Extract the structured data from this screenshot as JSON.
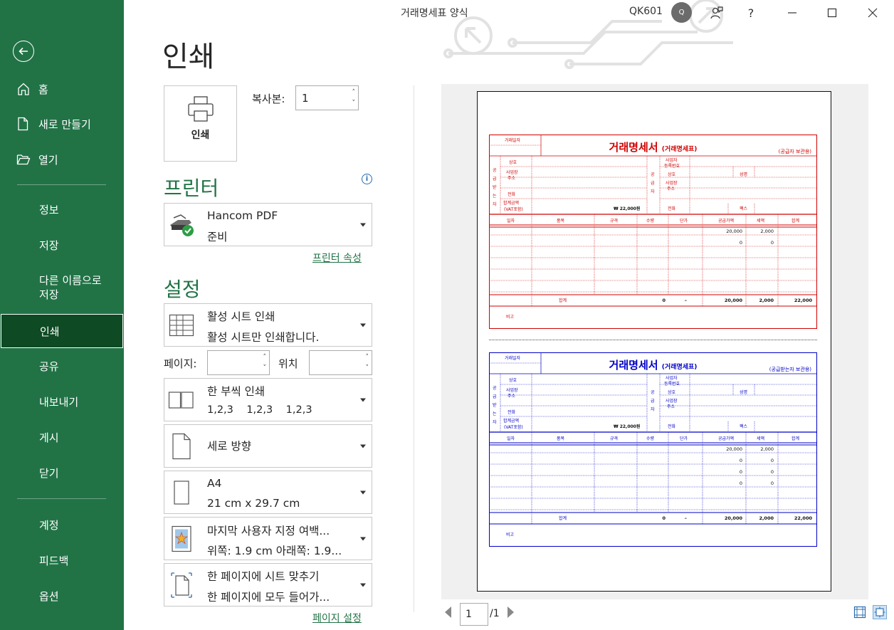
{
  "window": {
    "title": "거래명세표 양식",
    "user": "QK601",
    "avatar": "Q",
    "help": "?"
  },
  "nav": {
    "items": [
      {
        "label": "홈",
        "icon": "home-icon"
      },
      {
        "label": "새로 만들기",
        "icon": "new-document-icon"
      },
      {
        "label": "열기",
        "icon": "folder-open-icon"
      },
      {
        "label": "정보"
      },
      {
        "label": "저장"
      },
      {
        "label": "다른 이름으로\n저장"
      },
      {
        "label": "인쇄"
      },
      {
        "label": "공유"
      },
      {
        "label": "내보내기"
      },
      {
        "label": "게시"
      },
      {
        "label": "닫기"
      },
      {
        "label": "계정"
      },
      {
        "label": "피드백"
      },
      {
        "label": "옵션"
      }
    ],
    "save_as_line1": "다른 이름으로",
    "save_as_line2": "저장",
    "active": "인쇄"
  },
  "print": {
    "title": "인쇄",
    "button_label": "인쇄",
    "copies_label": "복사본:",
    "copies_value": "1"
  },
  "printer": {
    "section_title": "프린터",
    "name": "Hancom PDF",
    "status": "준비",
    "properties_link": "프린터 속성"
  },
  "settings": {
    "section_title": "설정",
    "what": {
      "line1": "활성 시트 인쇄",
      "line2": "활성 시트만 인쇄합니다."
    },
    "pages_label": "페이지:",
    "pages_value": "",
    "position_label": "위치",
    "position_value": "",
    "sides": {
      "line1": "한 부씩 인쇄",
      "line2": "1,2,3    1,2,3    1,2,3"
    },
    "orientation": {
      "line1": "세로 방향"
    },
    "paper": {
      "line1": "A4",
      "line2": "21 cm x 29.7 cm"
    },
    "margins": {
      "line1": "마지막 사용자 지정 여백...",
      "line2": "위쪽: 1.9 cm 아래쪽: 1.9..."
    },
    "scaling": {
      "line1": "한 페이지에 시트 맞추기",
      "line2": "한 페이지에 모두 들어가..."
    },
    "page_setup_link": "페이지 설정"
  },
  "preview": {
    "invoice_top": {
      "title": "거래명세서",
      "subtitle": "(거래명세표)",
      "note": "(공급자 보관용)",
      "color": "#d10000"
    },
    "invoice_bottom": {
      "title": "거래명세서",
      "subtitle": "(거래명세표)",
      "note": "(공급받는자 보관용)",
      "color": "#0000c8"
    },
    "page_current": "1",
    "page_total": "/1"
  }
}
